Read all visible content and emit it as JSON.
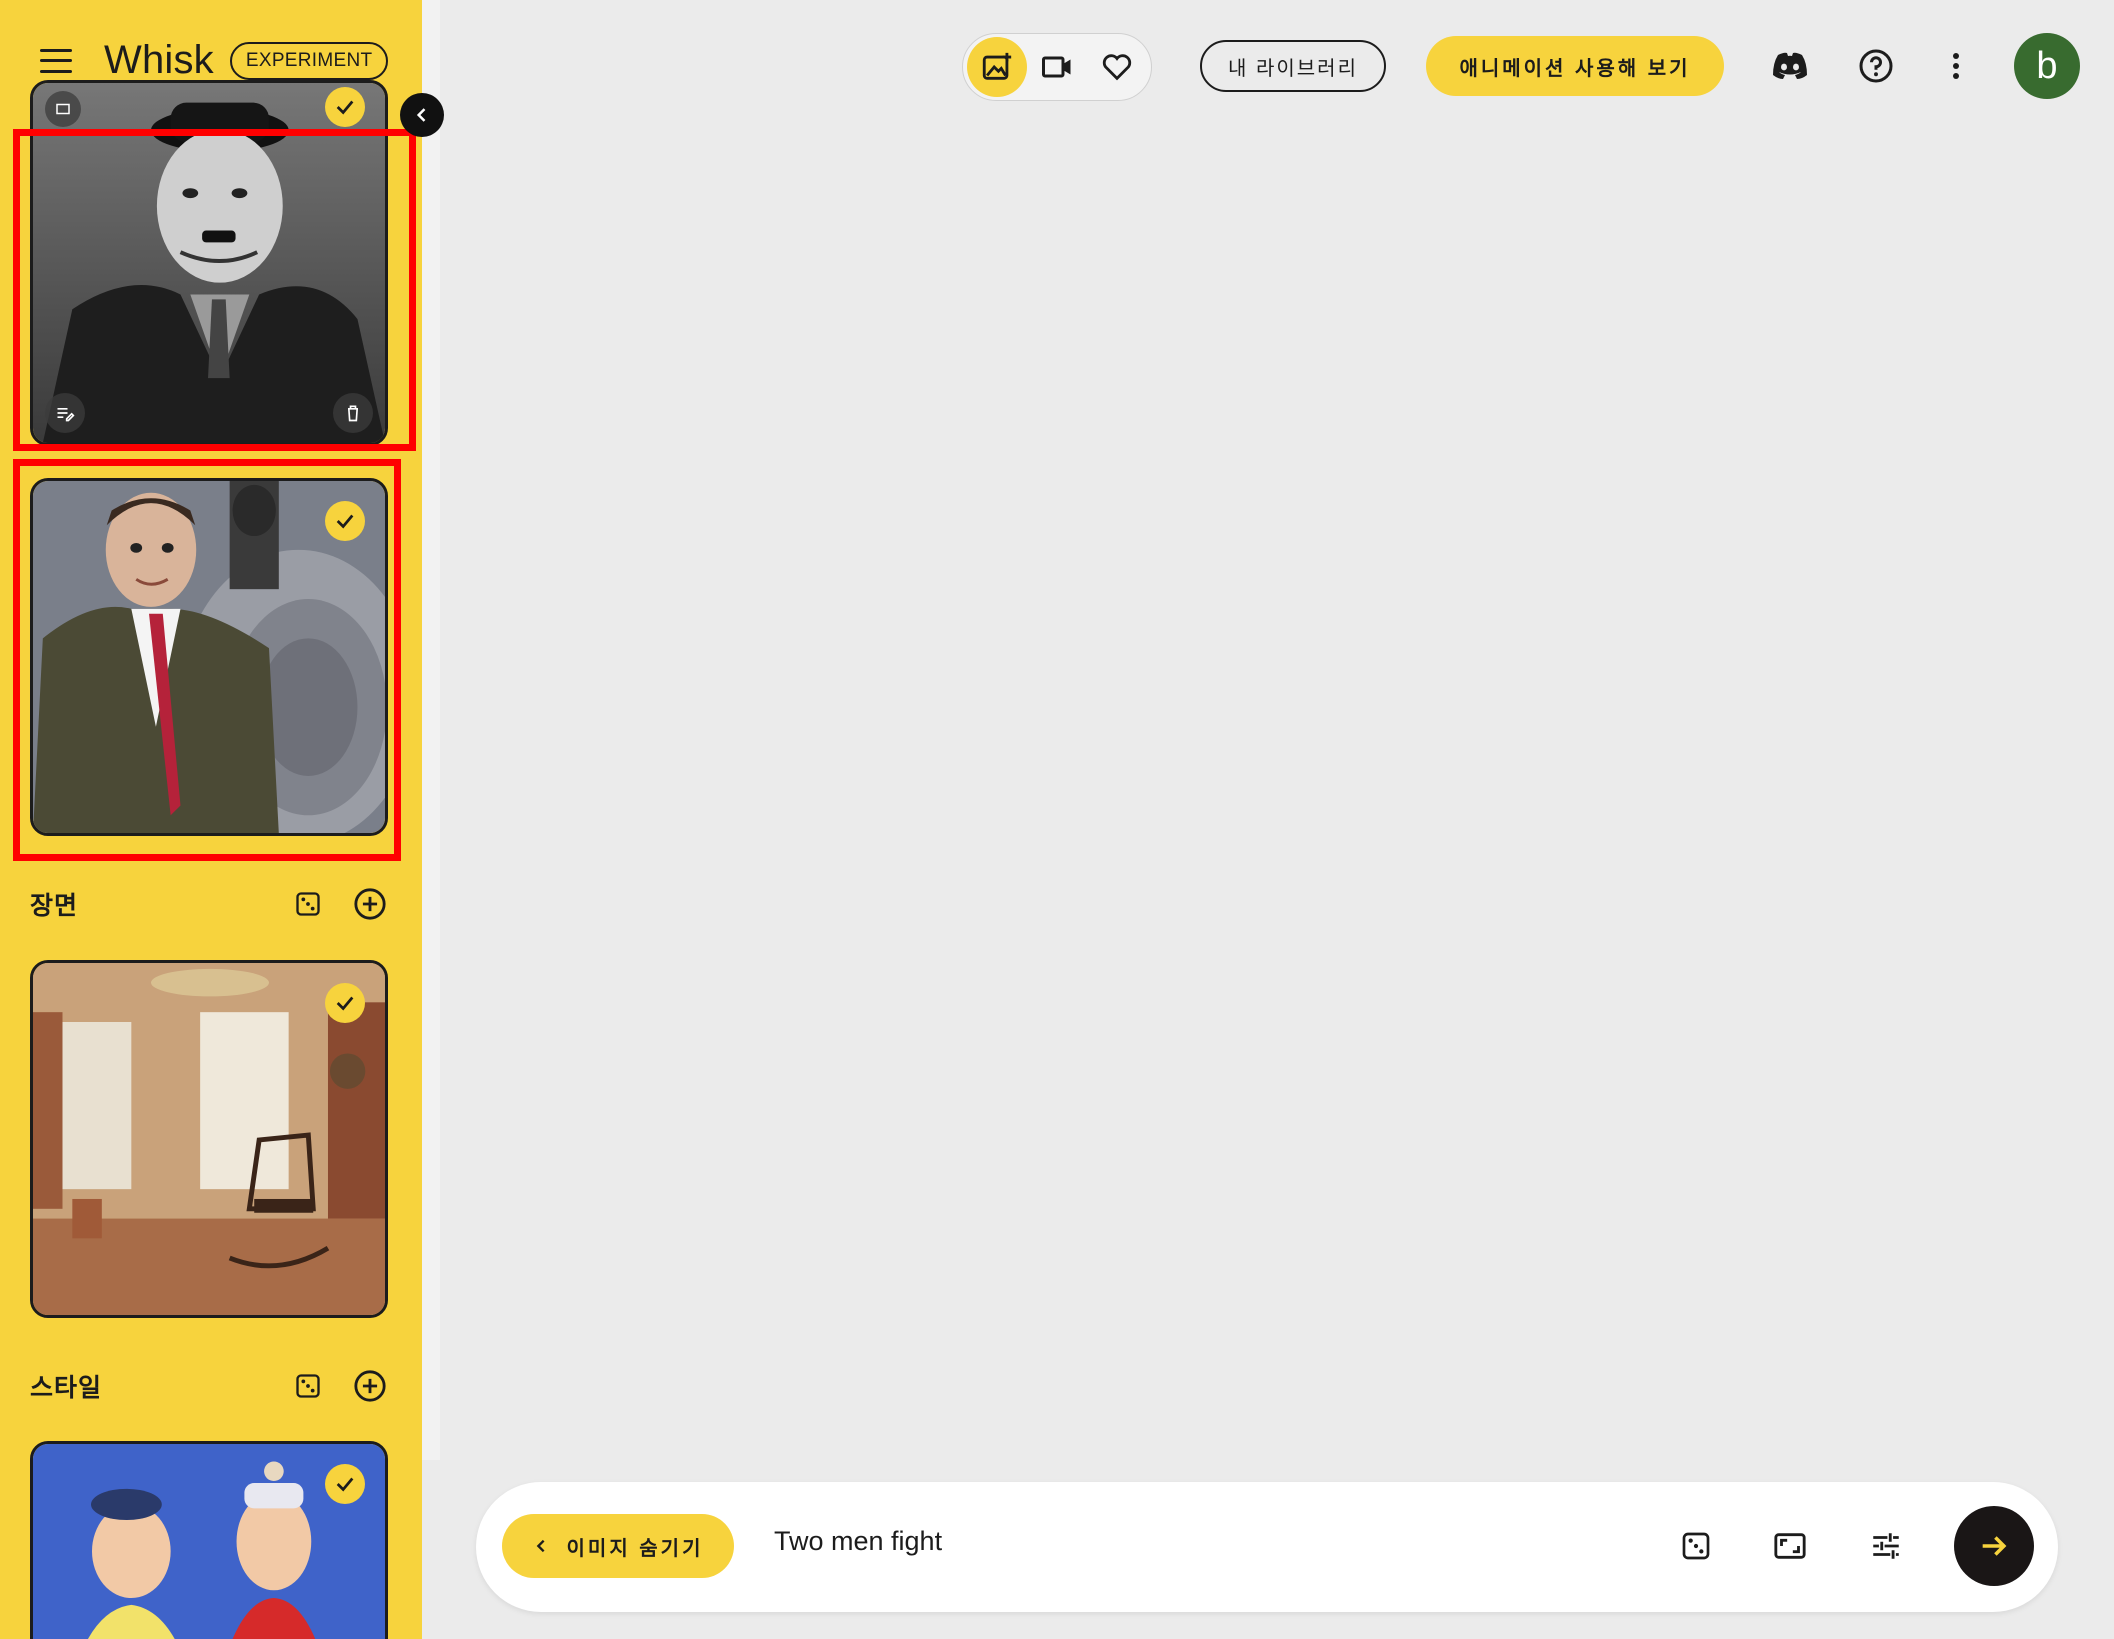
{
  "app": {
    "name": "Whisk",
    "badge": "EXPERIMENT"
  },
  "sidebar": {
    "sections": [
      {
        "title": "장면",
        "icons": [
          "dice-icon",
          "add-circle-icon"
        ]
      },
      {
        "title": "스타일",
        "icons": [
          "dice-icon",
          "add-circle-icon"
        ]
      }
    ],
    "cards": [
      {
        "subject": "chaplin-photo",
        "selected": true
      },
      {
        "subject": "mr-bean-photo",
        "selected": true
      },
      {
        "subject": "room-painting",
        "selected": true
      },
      {
        "subject": "puppets-photo",
        "selected": true
      }
    ]
  },
  "topbar": {
    "mode_icons": [
      "add-image-icon",
      "video-icon",
      "heart-icon"
    ],
    "library_label": "내 라이브러리",
    "animate_label": "애니메이션 사용해 보기",
    "icons": [
      "discord-icon",
      "help-icon",
      "more-vert-icon"
    ],
    "avatar_initial": "b"
  },
  "composer": {
    "hide_images_label": "이미지 숨기기",
    "prompt": "Two men fight",
    "icons": [
      "dice-icon",
      "aspect-ratio-icon",
      "tune-icon",
      "arrow-forward-icon"
    ]
  },
  "colors": {
    "accent": "#f7d33d",
    "highlight": "#ff0000",
    "avatar": "#386b2f",
    "background": "#ebebeb"
  }
}
